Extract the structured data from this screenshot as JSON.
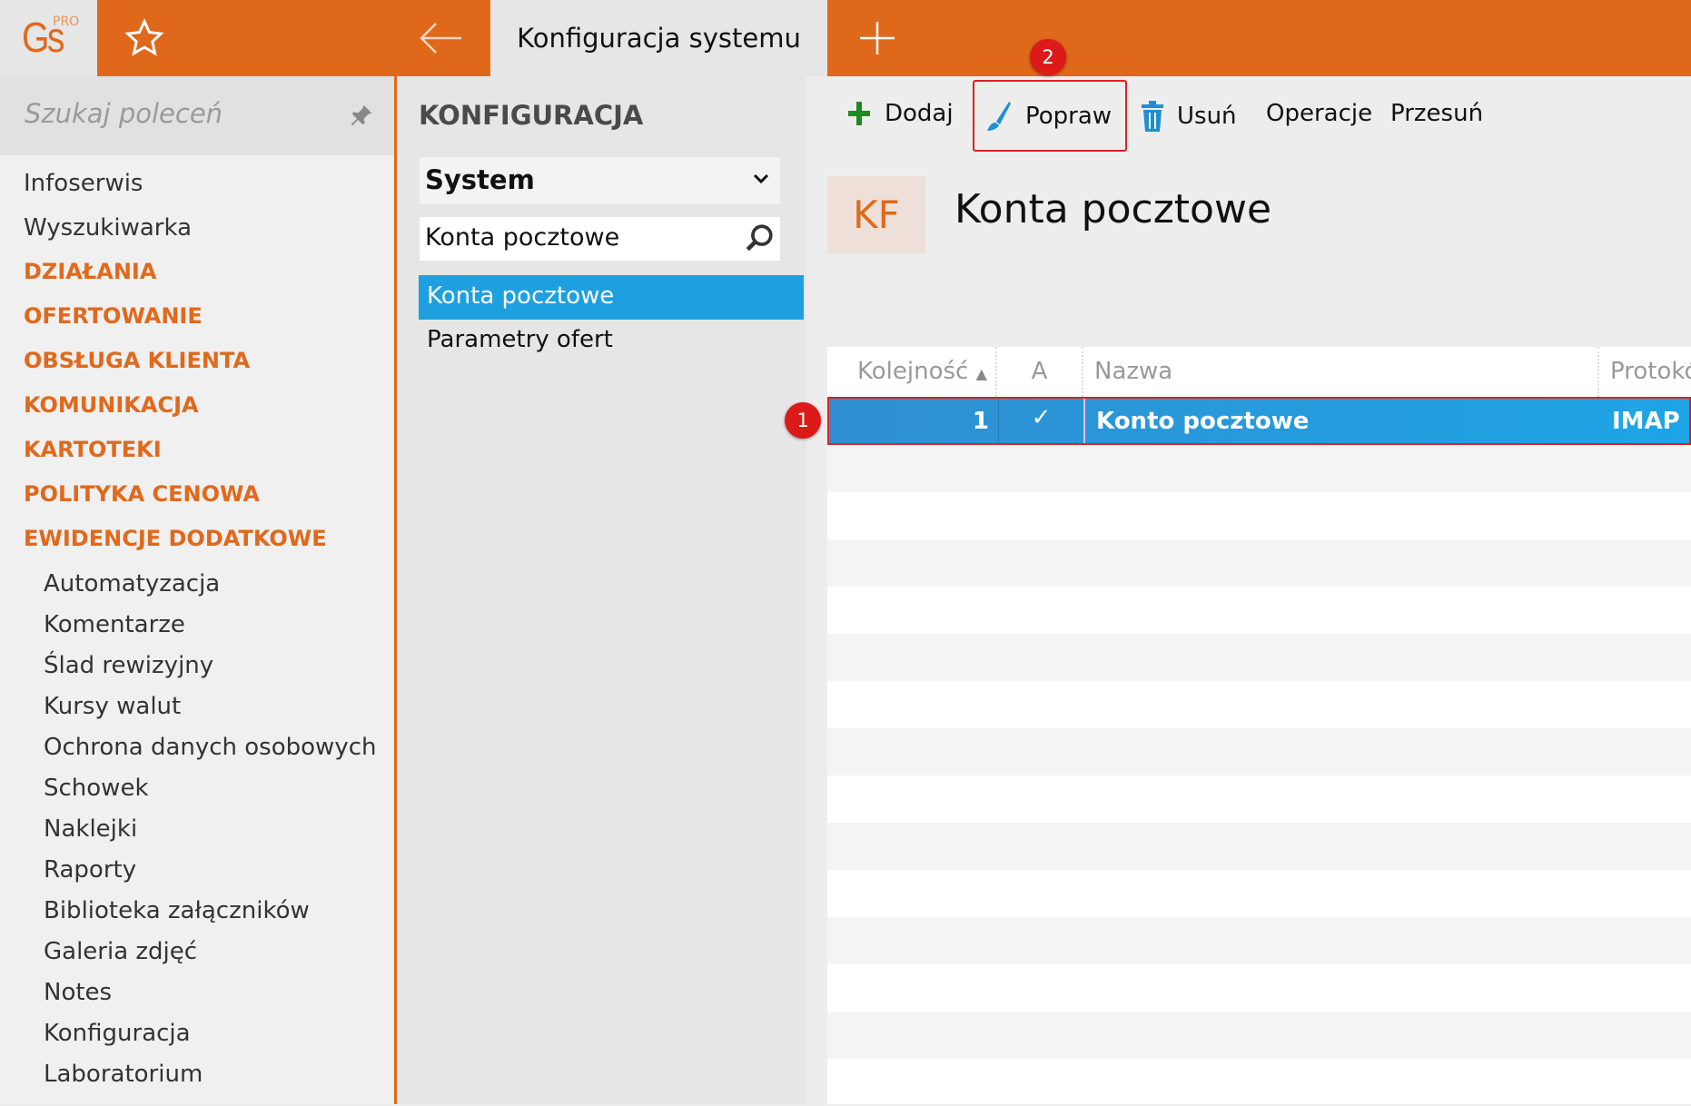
{
  "topbar": {
    "logo": "Gs",
    "logo_sup": "PRO",
    "tab_title": "Konfiguracja systemu",
    "icons": [
      "star-icon",
      "back-arrow-icon",
      "plus-icon"
    ]
  },
  "sidebar": {
    "search_placeholder": "Szukaj poleceń",
    "items": [
      {
        "label": "Infoserwis",
        "type": "link"
      },
      {
        "label": "Wyszukiwarka",
        "type": "link"
      },
      {
        "label": "DZIAŁANIA",
        "type": "cat"
      },
      {
        "label": "OFERTOWANIE",
        "type": "cat"
      },
      {
        "label": "OBSŁUGA KLIENTA",
        "type": "cat"
      },
      {
        "label": "KOMUNIKACJA",
        "type": "cat"
      },
      {
        "label": "KARTOTEKI",
        "type": "cat"
      },
      {
        "label": "POLITYKA CENOWA",
        "type": "cat"
      },
      {
        "label": "EWIDENCJE DODATKOWE",
        "type": "cat"
      },
      {
        "label": "Automatyzacja",
        "type": "sub"
      },
      {
        "label": "Komentarze",
        "type": "sub"
      },
      {
        "label": "Ślad rewizyjny",
        "type": "sub"
      },
      {
        "label": "Kursy walut",
        "type": "sub"
      },
      {
        "label": "Ochrona danych osobowych",
        "type": "sub"
      },
      {
        "label": "Schowek",
        "type": "sub"
      },
      {
        "label": "Naklejki",
        "type": "sub"
      },
      {
        "label": "Raporty",
        "type": "sub"
      },
      {
        "label": "Biblioteka załączników",
        "type": "sub"
      },
      {
        "label": "Galeria zdjęć",
        "type": "sub"
      },
      {
        "label": "Notes",
        "type": "sub"
      },
      {
        "label": "Konfiguracja",
        "type": "sub"
      },
      {
        "label": "Laboratorium",
        "type": "sub"
      }
    ]
  },
  "middle": {
    "title": "KONFIGURACJA",
    "select_value": "System",
    "search_value": "Konta pocztowe",
    "list": [
      "Konta pocztowe",
      "Parametry ofert"
    ]
  },
  "toolbar": {
    "add": "Dodaj",
    "edit": "Popraw",
    "delete": "Usuń",
    "operations": "Operacje",
    "move": "Przesuń"
  },
  "badges": {
    "one": "1",
    "two": "2"
  },
  "content": {
    "icon_text": "KF",
    "title": "Konta pocztowe"
  },
  "table": {
    "columns": [
      "Kolejność",
      "A",
      "Nazwa",
      "Protokó"
    ],
    "rows": [
      {
        "order": "1",
        "active": "✓",
        "name": "Konto pocztowe",
        "protocol": "IMAP"
      }
    ]
  }
}
